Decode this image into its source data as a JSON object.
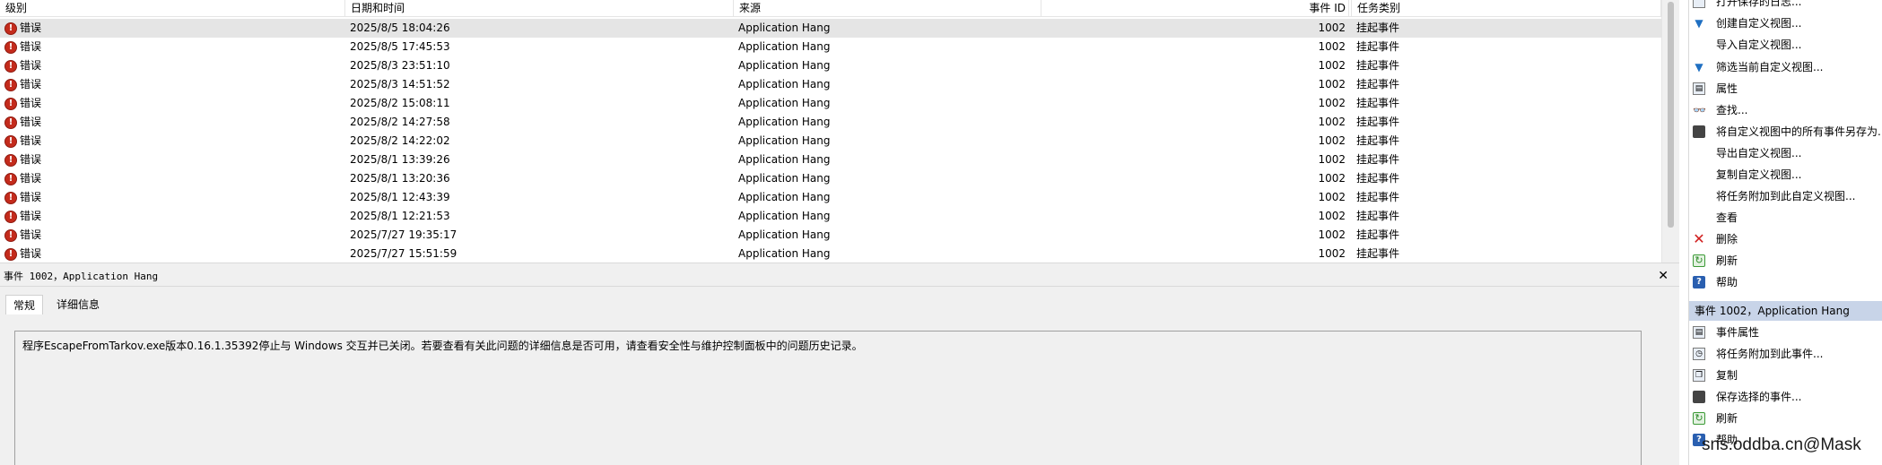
{
  "list": {
    "headers": {
      "level": "级别",
      "date": "日期和时间",
      "source": "来源",
      "event_id": "事件 ID",
      "category": "任务类别"
    },
    "rows": [
      {
        "level": "错误",
        "date": "2025/8/5 18:04:26",
        "source": "Application Hang",
        "event_id": "1002",
        "category": "挂起事件"
      },
      {
        "level": "错误",
        "date": "2025/8/5 17:45:53",
        "source": "Application Hang",
        "event_id": "1002",
        "category": "挂起事件"
      },
      {
        "level": "错误",
        "date": "2025/8/3 23:51:10",
        "source": "Application Hang",
        "event_id": "1002",
        "category": "挂起事件"
      },
      {
        "level": "错误",
        "date": "2025/8/3 14:51:52",
        "source": "Application Hang",
        "event_id": "1002",
        "category": "挂起事件"
      },
      {
        "level": "错误",
        "date": "2025/8/2 15:08:11",
        "source": "Application Hang",
        "event_id": "1002",
        "category": "挂起事件"
      },
      {
        "level": "错误",
        "date": "2025/8/2 14:27:58",
        "source": "Application Hang",
        "event_id": "1002",
        "category": "挂起事件"
      },
      {
        "level": "错误",
        "date": "2025/8/2 14:22:02",
        "source": "Application Hang",
        "event_id": "1002",
        "category": "挂起事件"
      },
      {
        "level": "错误",
        "date": "2025/8/1 13:39:26",
        "source": "Application Hang",
        "event_id": "1002",
        "category": "挂起事件"
      },
      {
        "level": "错误",
        "date": "2025/8/1 13:20:36",
        "source": "Application Hang",
        "event_id": "1002",
        "category": "挂起事件"
      },
      {
        "level": "错误",
        "date": "2025/8/1 12:43:39",
        "source": "Application Hang",
        "event_id": "1002",
        "category": "挂起事件"
      },
      {
        "level": "错误",
        "date": "2025/8/1 12:21:53",
        "source": "Application Hang",
        "event_id": "1002",
        "category": "挂起事件"
      },
      {
        "level": "错误",
        "date": "2025/7/27 19:35:17",
        "source": "Application Hang",
        "event_id": "1002",
        "category": "挂起事件"
      },
      {
        "level": "错误",
        "date": "2025/7/27 15:51:59",
        "source": "Application Hang",
        "event_id": "1002",
        "category": "挂起事件"
      }
    ],
    "selected_index": 0
  },
  "detail": {
    "title": "事件 1002，Application Hang",
    "close_glyph": "✕",
    "tabs": [
      "常规",
      "详细信息"
    ],
    "active_tab": 0,
    "message": "程序EscapeFromTarkov.exe版本0.16.1.35392停止与 Windows 交互并已关闭。若要查看有关此问题的详细信息是否可用，请查看安全性与维护控制面板中的问题历史记录。"
  },
  "actions": {
    "view_items": [
      {
        "label": "打开保存的日志...",
        "icon": "open-log-icon"
      },
      {
        "label": "创建自定义视图...",
        "icon": "filter-icon"
      },
      {
        "label": "导入自定义视图...",
        "icon": ""
      },
      {
        "label": "筛选当前自定义视图...",
        "icon": "filter-icon"
      },
      {
        "label": "属性",
        "icon": "properties-icon"
      },
      {
        "label": "查找...",
        "icon": "find-icon"
      },
      {
        "label": "将自定义视图中的所有事件另存为...",
        "icon": "save-icon"
      },
      {
        "label": "导出自定义视图...",
        "icon": ""
      },
      {
        "label": "复制自定义视图...",
        "icon": ""
      },
      {
        "label": "将任务附加到此自定义视图...",
        "icon": ""
      },
      {
        "label": "查看",
        "icon": ""
      },
      {
        "label": "删除",
        "icon": "delete-icon"
      },
      {
        "label": "刷新",
        "icon": "refresh-icon"
      },
      {
        "label": "帮助",
        "icon": "help-icon"
      }
    ],
    "event_section_title": "事件 1002，Application Hang",
    "event_items": [
      {
        "label": "事件属性",
        "icon": "properties-icon"
      },
      {
        "label": "将任务附加到此事件...",
        "icon": "task-icon"
      },
      {
        "label": "复制",
        "icon": "copy-icon"
      },
      {
        "label": "保存选择的事件...",
        "icon": "save-icon"
      },
      {
        "label": "刷新",
        "icon": "refresh-icon"
      },
      {
        "label": "帮助",
        "icon": "help-icon"
      }
    ]
  },
  "watermark": "sns.oddba.cn@Mask"
}
